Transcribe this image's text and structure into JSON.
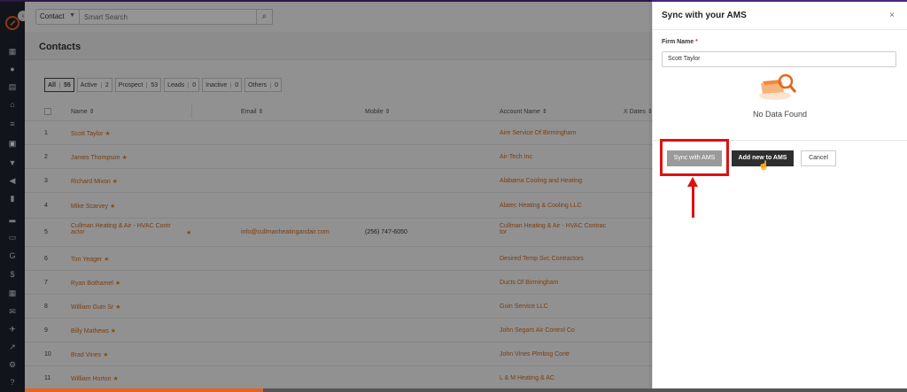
{
  "sidebar": {
    "icons": [
      "logo-icon",
      "dashboard-icon",
      "users-icon",
      "docs-icon",
      "bank-icon",
      "list-icon",
      "contacts-icon",
      "filter-icon",
      "megaphone-icon",
      "file-icon",
      "chart-icon",
      "folder-icon",
      "g-icon",
      "dollar-icon",
      "calendar-icon",
      "mail-icon",
      "plane-icon",
      "trend-icon",
      "gear-icon",
      "help-icon"
    ]
  },
  "searchbar": {
    "type_value": "Contact",
    "placeholder": "Smart Search"
  },
  "page": {
    "title": "Contacts"
  },
  "filters": [
    {
      "label": "All",
      "count": "55"
    },
    {
      "label": "Active",
      "count": "2"
    },
    {
      "label": "Prospect",
      "count": "53"
    },
    {
      "label": "Leads",
      "count": "0"
    },
    {
      "label": "Inactive",
      "count": "0"
    },
    {
      "label": "Others",
      "count": "0"
    }
  ],
  "table": {
    "headers": {
      "name": "Name ⇕",
      "email": "Email ⇕",
      "mobile": "Mobile ⇕",
      "account": "Account Name ⇕",
      "xdates": "X Dates ⇕"
    },
    "rows": [
      {
        "num": "1",
        "name": "Scott Taylor",
        "email": "",
        "mobile": "",
        "account": "Aire Service Of Birmingham"
      },
      {
        "num": "2",
        "name": "James Thompson",
        "email": "",
        "mobile": "",
        "account": "Air-Tech Inc"
      },
      {
        "num": "3",
        "name": "Richard Mixon",
        "email": "",
        "mobile": "",
        "account": "Alabama Cooling and Heating"
      },
      {
        "num": "4",
        "name": "Mike Scarvey",
        "email": "",
        "mobile": "",
        "account": "Alatec Heating & Cooling LLC"
      },
      {
        "num": "5",
        "name": "Cullman Heating & Air - HVAC Contr actor",
        "email": "info@cullmanheatingandair.com",
        "mobile": "(256) 747-6050",
        "account": "Cullman Heating & Air - HVAC Contrac tor"
      },
      {
        "num": "6",
        "name": "Tim Yeager",
        "email": "",
        "mobile": "",
        "account": "Desired Temp Svc Contractors"
      },
      {
        "num": "7",
        "name": "Ryan Bothamel",
        "email": "",
        "mobile": "",
        "account": "Ducts Of Birmingham"
      },
      {
        "num": "8",
        "name": "William Guin Sr",
        "email": "",
        "mobile": "",
        "account": "Guin Service LLC"
      },
      {
        "num": "9",
        "name": "Billy Mathews",
        "email": "",
        "mobile": "",
        "account": "John Segars Air Control Co"
      },
      {
        "num": "10",
        "name": "Brad Vines",
        "email": "",
        "mobile": "",
        "account": "John Vines Plmbng Contr"
      },
      {
        "num": "11",
        "name": "William Horton",
        "email": "",
        "mobile": "",
        "account": "L & M Heating & AC"
      }
    ]
  },
  "panel": {
    "title": "Sync with your AMS",
    "close": "×",
    "field_label": "Firm Name",
    "required_mark": "*",
    "firm_name": "Scott Taylor",
    "no_data": "No Data Found",
    "buttons": {
      "sync": "Sync with AMS",
      "add": "Add new to AMS",
      "cancel": "Cancel"
    }
  },
  "colors": {
    "accent": "#e8641c",
    "link": "#d56b1a",
    "highlight": "#e01010",
    "sidebar": "#1f2430"
  },
  "video_progress": 0.27
}
